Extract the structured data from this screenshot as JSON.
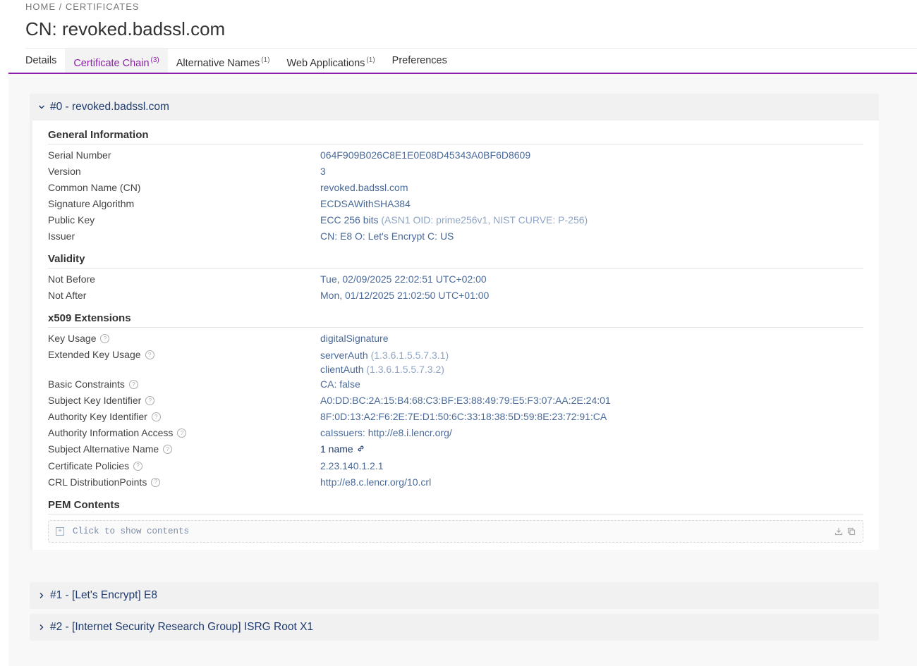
{
  "breadcrumb": {
    "home": "HOME",
    "sep": "/",
    "current": "CERTIFICATES"
  },
  "title": "CN: revoked.badssl.com",
  "tabs": [
    {
      "label": "Details",
      "count": ""
    },
    {
      "label": "Certificate Chain",
      "count": "(3)"
    },
    {
      "label": "Alternative Names",
      "count": "(1)"
    },
    {
      "label": "Web Applications",
      "count": "(1)"
    },
    {
      "label": "Preferences",
      "count": ""
    }
  ],
  "chain": [
    {
      "title": "#0 - revoked.badssl.com"
    },
    {
      "title": "#1 - [Let's Encrypt] E8"
    },
    {
      "title": "#2 - [Internet Security Research Group] ISRG Root X1"
    }
  ],
  "general": {
    "heading": "General Information",
    "serial_label": "Serial Number",
    "serial": "064F909B026C8E1E0E08D45343A0BF6D8609",
    "version_label": "Version",
    "version": "3",
    "cn_label": "Common Name (CN)",
    "cn": "revoked.badssl.com",
    "sigalg_label": "Signature Algorithm",
    "sigalg": "ECDSAWithSHA384",
    "pubkey_label": "Public Key",
    "pubkey": "ECC 256 bits",
    "pubkey_detail": "(ASN1 OID: prime256v1, NIST CURVE: P-256)",
    "issuer_label": "Issuer",
    "issuer": "CN: E8 O: Let's Encrypt C: US"
  },
  "validity": {
    "heading": "Validity",
    "not_before_label": "Not Before",
    "not_before": "Tue, 02/09/2025 22:02:51 UTC+02:00",
    "not_after_label": "Not After",
    "not_after": "Mon, 01/12/2025 21:02:50 UTC+01:00"
  },
  "ext": {
    "heading": "x509 Extensions",
    "key_usage_label": "Key Usage",
    "key_usage": "digitalSignature",
    "eku_label": "Extended Key Usage",
    "eku1": "serverAuth",
    "eku1_oid": "(1.3.6.1.5.5.7.3.1)",
    "eku2": "clientAuth",
    "eku2_oid": "(1.3.6.1.5.5.7.3.2)",
    "basic_label": "Basic Constraints",
    "basic": "CA: false",
    "ski_label": "Subject Key Identifier",
    "ski": "A0:DD:BC:2A:15:B4:68:C3:BF:E3:88:49:79:E5:F3:07:AA:2E:24:01",
    "aki_label": "Authority Key Identifier",
    "aki": "8F:0D:13:A2:F6:2E:7E:D1:50:6C:33:18:38:5D:59:8E:23:72:91:CA",
    "aia_label": "Authority Information Access",
    "aia": "caIssuers: http://e8.i.lencr.org/",
    "san_label": "Subject Alternative Name",
    "san": "1 name",
    "policies_label": "Certificate Policies",
    "policies": "2.23.140.1.2.1",
    "crl_label": "CRL DistributionPoints",
    "crl": "http://e8.c.lencr.org/10.crl"
  },
  "pem": {
    "heading": "PEM Contents",
    "placeholder": "Click to show contents"
  },
  "help_glyph": "?",
  "colors": {
    "accent": "#8b1fa9",
    "value": "#4a6a9a",
    "panel_title": "#1e3a6e"
  }
}
